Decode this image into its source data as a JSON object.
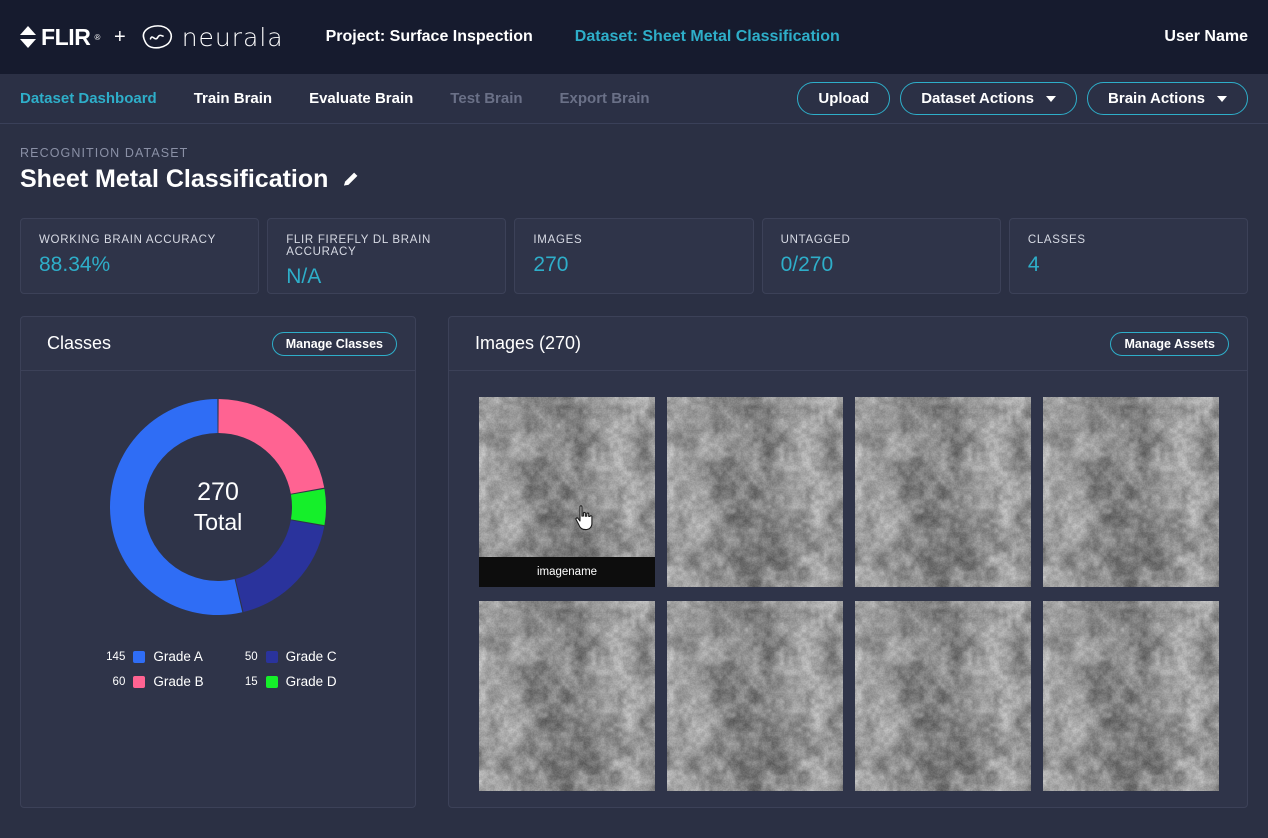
{
  "header": {
    "flir_brand": "FLIR",
    "flir_tm": "®",
    "plus": "+",
    "neurala_brand": "neurala",
    "project": "Project: Surface Inspection",
    "dataset": "Dataset: Sheet Metal Classification",
    "user": "User Name"
  },
  "nav": {
    "items": [
      {
        "label": "Dataset Dashboard",
        "state": "active"
      },
      {
        "label": "Train Brain",
        "state": "normal"
      },
      {
        "label": "Evaluate Brain",
        "state": "normal"
      },
      {
        "label": "Test Brain",
        "state": "disabled"
      },
      {
        "label": "Export Brain",
        "state": "disabled"
      }
    ],
    "upload_label": "Upload",
    "dataset_actions_label": "Dataset Actions",
    "brain_actions_label": "Brain Actions"
  },
  "page": {
    "eyebrow": "RECOGNITION DATASET",
    "title": "Sheet Metal Classification"
  },
  "stats": [
    {
      "label": "WORKING BRAIN ACCURACY",
      "value": "88.34%"
    },
    {
      "label": "FLIR FIREFLY DL BRAIN ACCURACY",
      "value": "N/A"
    },
    {
      "label": "IMAGES",
      "value": "270"
    },
    {
      "label": "UNTAGGED",
      "value": "0/270"
    },
    {
      "label": "CLASSES",
      "value": "4"
    }
  ],
  "classes_panel": {
    "title": "Classes",
    "manage_label": "Manage Classes",
    "total_value": "270",
    "total_word": "Total"
  },
  "images_panel": {
    "title": "Images (270)",
    "manage_label": "Manage Assets",
    "first_thumb_caption": "imagename",
    "thumbnails": [
      {
        "caption": "imagename",
        "hovered": true
      },
      {
        "caption": "",
        "hovered": false
      },
      {
        "caption": "",
        "hovered": false
      },
      {
        "caption": "",
        "hovered": false
      },
      {
        "caption": "",
        "hovered": false
      },
      {
        "caption": "",
        "hovered": false
      },
      {
        "caption": "",
        "hovered": false
      },
      {
        "caption": "",
        "hovered": false
      }
    ]
  },
  "colors": {
    "accent": "#2eaec9",
    "page_bg": "#2b3044",
    "header_bg": "#161b2e",
    "nav_bg": "#2b3045",
    "card_bg": "#2f3449",
    "card_border": "#3c4158",
    "grade_a": "#2f6df5",
    "grade_b": "#ff6392",
    "grade_c": "#2a339c",
    "grade_d": "#15ef2a"
  },
  "chart_data": {
    "type": "pie",
    "title": "Classes",
    "center_label": "270 Total",
    "total": 270,
    "categories": [
      "Grade A",
      "Grade B",
      "Grade C",
      "Grade D"
    ],
    "values": [
      145,
      60,
      50,
      15
    ],
    "colors": [
      "#2f6df5",
      "#ff6392",
      "#2a339c",
      "#15ef2a"
    ],
    "draw_order": [
      "Grade B",
      "Grade D",
      "Grade C",
      "Grade A"
    ],
    "legend": [
      {
        "count": "145",
        "label": "Grade A",
        "color": "#2f6df5"
      },
      {
        "count": "60",
        "label": "Grade B",
        "color": "#ff6392"
      },
      {
        "count": "50",
        "label": "Grade C",
        "color": "#2a339c"
      },
      {
        "count": "15",
        "label": "Grade D",
        "color": "#15ef2a"
      }
    ],
    "legend_position": "bottom",
    "donut": true,
    "start_angle_deg": 0
  }
}
